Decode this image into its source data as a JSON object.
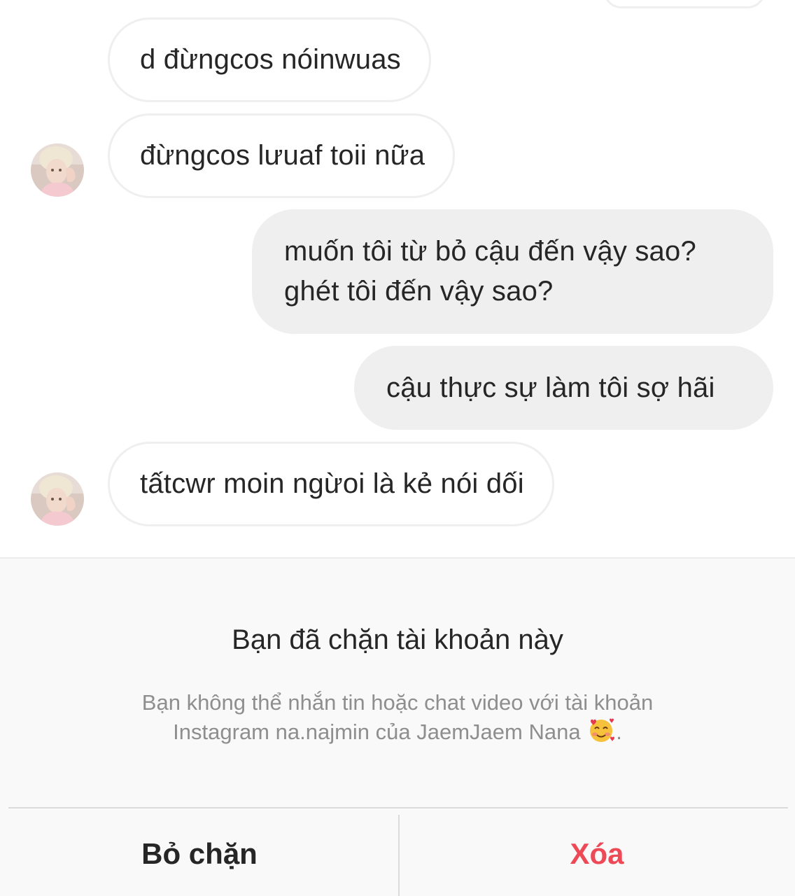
{
  "messages": [
    {
      "direction": "incoming",
      "show_avatar": false,
      "lines": [
        "d đừngcos nóinwuas"
      ]
    },
    {
      "direction": "incoming",
      "show_avatar": true,
      "lines": [
        "đừngcos lưuaf toii nữa"
      ]
    },
    {
      "direction": "outgoing",
      "lines": [
        "muốn tôi từ bỏ cậu đến vậy sao?",
        "ghét tôi đến vậy sao?"
      ]
    },
    {
      "direction": "outgoing",
      "lines": [
        "cậu thực sự làm tôi sợ hãi"
      ]
    },
    {
      "direction": "incoming",
      "show_avatar": true,
      "lines": [
        "tấtcwr moin ngừoi là kẻ nói dối"
      ]
    }
  ],
  "blocked_notice": {
    "title": "Bạn đã chặn tài khoản này",
    "description_line1": "Bạn không thể nhắn tin hoặc chat video với tài khoản",
    "description_line2": "Instagram na.najmin của JaemJaem Nana",
    "description_emoji": "smiling-face-with-hearts",
    "description_end": "."
  },
  "actions": {
    "unblock_label": "Bỏ chặn",
    "delete_label": "Xóa"
  },
  "colors": {
    "incoming_bubble_border": "#efefef",
    "outgoing_bubble_bg": "#efefef",
    "text": "#262626",
    "secondary_text": "#8e8e8e",
    "delete": "#ed4956",
    "panel_bg": "#f9f9f9"
  }
}
